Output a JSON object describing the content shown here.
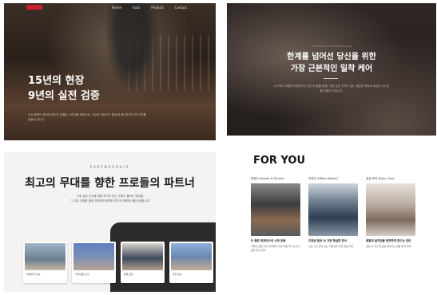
{
  "panel1": {
    "nav": [
      "Home",
      "Auto",
      "Product",
      "Contact"
    ],
    "headline_line1": "15년의 현장",
    "headline_line2": "9년의 실전 검증",
    "body": "이상 경력이 쌓이며 얻어진 검증된 노하우를 바탕으로, 선수와 전문가가 함께 땀 흘리며 최고의 가치를 만들어 갑니다."
  },
  "panel2": {
    "eyebrow": "Intensive Conditioning",
    "headline_line1": "한계를 넘어선 당신을 위한",
    "headline_line2": "가장 근본적인 밀착 케어",
    "body": "누구보다 치열하게 움직이는 당신의 몸을 위해, 가장 깊은 곳까지 닿는 세심한 케어로 최상의 컨디션을 되찾아 드립니다."
  },
  "panel3": {
    "eyebrow": "PARTNERSHIP",
    "headline": "최고의 무대를 향한 프로들의 파트너",
    "desc_line1": "가장 높은 순간을 위해 보이지 않는 곳에서 흘리는 땀방울,",
    "desc_line2": "그 고된 여정을 함께 지원하며 완벽한 최고의 퍼포먼스를 완성합니다.",
    "cards": [
      "아마추어 선수",
      "국가대표 선수",
      "유명 선수",
      "우리 선수"
    ]
  },
  "panel4": {
    "title": "FOR YOU",
    "columns": [
      {
        "label": "운동인 (Sports & Fitness)",
        "caption": "더 좋은 퍼포먼스의 시작 운동",
        "desc": "격렬한 운동 뒤의 회복부터 부상 예방까지 당신의 몸을 위한 케어"
      },
      {
        "label": "직장인 (Office Worker)",
        "caption": "긴장된 일상 속 가장 확실한 휴식",
        "desc": "오랜 시간 앉아 있는 직장인을 위한 맞춤 케어"
      },
      {
        "label": "일상 케어 (Daily Care)",
        "caption": "매일의 움직임을 편안하게 만드는 관리",
        "desc": "일상 속 쌓인 피로를 풀어주는 생활 밀착 케어"
      }
    ]
  }
}
